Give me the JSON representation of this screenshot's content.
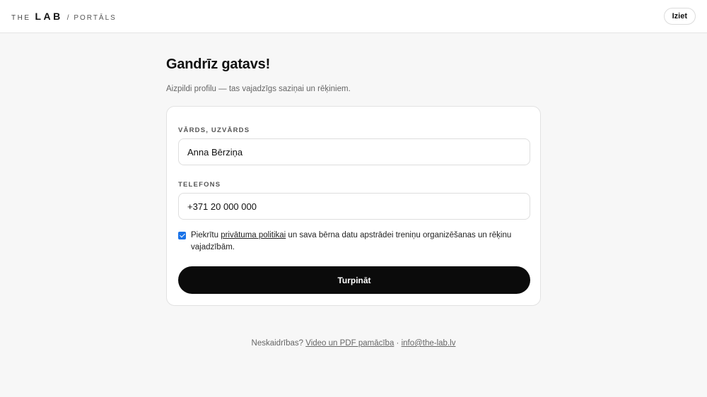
{
  "header": {
    "brand": {
      "the": "THE",
      "lab": "LAB",
      "portal": "/ PORTĀLS"
    },
    "logout_label": "Iziet"
  },
  "main": {
    "title": "Gandrīz gatavs!",
    "subtitle": "Aizpildi profilu — tas vajadzīgs saziņai un rēķiniem."
  },
  "form": {
    "name": {
      "label": "VĀRDS, UZVĀRDS",
      "value": "Anna Bērziņa"
    },
    "phone": {
      "label": "TELEFONS",
      "value": "+371 20 000 000"
    },
    "consent": {
      "checked": true,
      "prefix": "Piekrītu ",
      "link_text": "privātuma politikai",
      "suffix": " un sava bērna datu apstrādei treniņu organizēšanas un rēķinu vajadzībām."
    },
    "submit_label": "Turpināt"
  },
  "footer": {
    "prefix": "Neskaidrības? ",
    "help_link": "Video un PDF pamācība",
    "separator": " · ",
    "email_link": "info@the-lab.lv"
  },
  "colors": {
    "accent": "#0b0b0b",
    "checkbox": "#1a73e8",
    "background": "#f7f7f7"
  }
}
